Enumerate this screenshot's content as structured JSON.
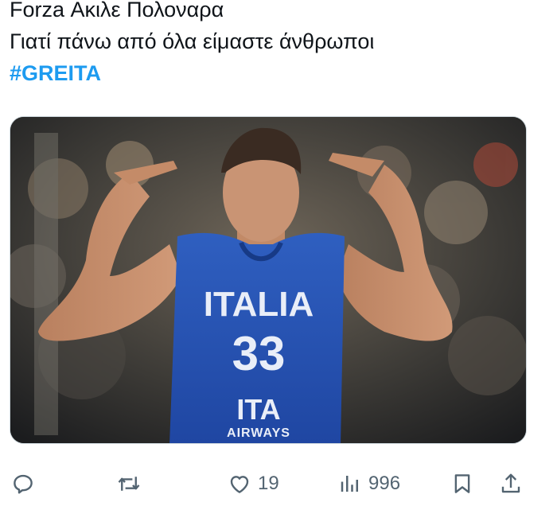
{
  "tweet": {
    "line1": "Forza Ακιλε Πολοναρα",
    "line2": "Γιατί πάνω από όλα είμαστε άνθρωποι",
    "hashtag": "#GREITA"
  },
  "media": {
    "jersey_text": "ITALIA",
    "jersey_number": "33",
    "sponsor_logo": "ITA",
    "sponsor_text": "AIRWAYS"
  },
  "actions": {
    "reply_icon": "reply-icon",
    "retweet_icon": "retweet-icon",
    "like_icon": "heart-icon",
    "like_count": "19",
    "views_icon": "views-chart-icon",
    "views_count": "996",
    "bookmark_icon": "bookmark-icon",
    "share_icon": "share-icon",
    "accent_color": "#1d9bf0",
    "icon_color": "#536471"
  }
}
